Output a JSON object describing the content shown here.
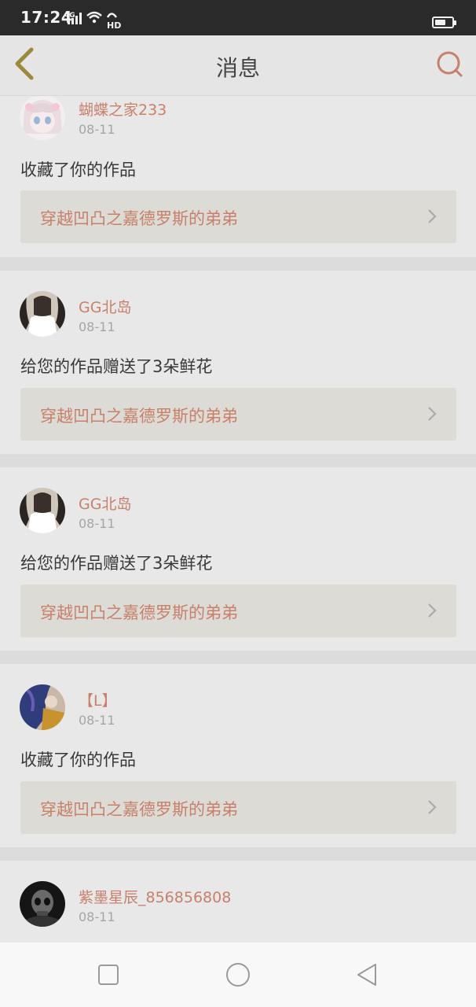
{
  "status": {
    "time": "17:24",
    "network": "4G",
    "hd": "HD"
  },
  "header": {
    "title": "消息"
  },
  "messages": [
    {
      "user": "蝴蝶之家233",
      "date": "08-11",
      "action": "收藏了你的作品",
      "work": "穿越凹凸之嘉德罗斯的弟弟"
    },
    {
      "user": "GG北岛",
      "date": "08-11",
      "action": "给您的作品赠送了3朵鲜花",
      "work": "穿越凹凸之嘉德罗斯的弟弟"
    },
    {
      "user": "GG北岛",
      "date": "08-11",
      "action": "给您的作品赠送了3朵鲜花",
      "work": "穿越凹凸之嘉德罗斯的弟弟"
    },
    {
      "user": "【L】",
      "date": "08-11",
      "action": "收藏了你的作品",
      "work": "穿越凹凸之嘉德罗斯的弟弟"
    },
    {
      "user": "紫墨星辰_856856808",
      "date": "08-11"
    }
  ],
  "colors": {
    "accent": "#c8806a",
    "back_arrow": "#9b8a3c"
  }
}
